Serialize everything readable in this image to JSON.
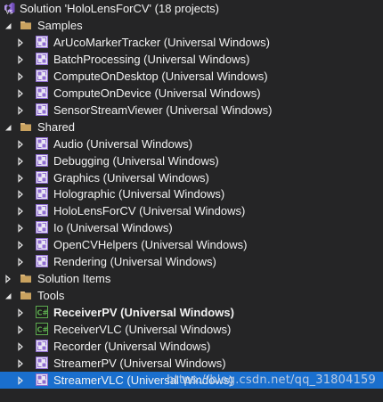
{
  "solution": {
    "label": "Solution 'HoloLensForCV' (18 projects)",
    "icon": "visual-studio-solution-icon"
  },
  "groups": [
    {
      "name": "Samples",
      "expanded": true,
      "items": [
        {
          "label": "ArUcoMarkerTracker (Universal Windows)",
          "kind": "cpp"
        },
        {
          "label": "BatchProcessing (Universal Windows)",
          "kind": "cpp"
        },
        {
          "label": "ComputeOnDesktop (Universal Windows)",
          "kind": "cpp"
        },
        {
          "label": "ComputeOnDevice (Universal Windows)",
          "kind": "cpp"
        },
        {
          "label": "SensorStreamViewer (Universal Windows)",
          "kind": "cpp"
        }
      ]
    },
    {
      "name": "Shared",
      "expanded": true,
      "items": [
        {
          "label": "Audio (Universal Windows)",
          "kind": "cpp"
        },
        {
          "label": "Debugging (Universal Windows)",
          "kind": "cpp"
        },
        {
          "label": "Graphics (Universal Windows)",
          "kind": "cpp"
        },
        {
          "label": "Holographic (Universal Windows)",
          "kind": "cpp"
        },
        {
          "label": "HoloLensForCV (Universal Windows)",
          "kind": "cpp"
        },
        {
          "label": "Io (Universal Windows)",
          "kind": "cpp"
        },
        {
          "label": "OpenCVHelpers (Universal Windows)",
          "kind": "cpp"
        },
        {
          "label": "Rendering (Universal Windows)",
          "kind": "cpp"
        }
      ]
    },
    {
      "name": "Solution Items",
      "expanded": false,
      "items": []
    },
    {
      "name": "Tools",
      "expanded": true,
      "items": [
        {
          "label": "ReceiverPV (Universal Windows)",
          "kind": "csharp",
          "bold": true
        },
        {
          "label": "ReceiverVLC (Universal Windows)",
          "kind": "csharp"
        },
        {
          "label": "Recorder (Universal Windows)",
          "kind": "cpp"
        },
        {
          "label": "StreamerPV (Universal Windows)",
          "kind": "cpp"
        },
        {
          "label": "StreamerVLC (Universal Windows)",
          "kind": "cpp",
          "selected": true
        }
      ]
    }
  ],
  "watermark": "https://blog.csdn.net/qq_31804159",
  "colors": {
    "background": "#252526",
    "selection": "#1a6fce",
    "text": "#f1f1f1",
    "folder": "#dcb67a",
    "vs_purple": "#8e6bd1",
    "csharp_green": "#5dab4f"
  }
}
